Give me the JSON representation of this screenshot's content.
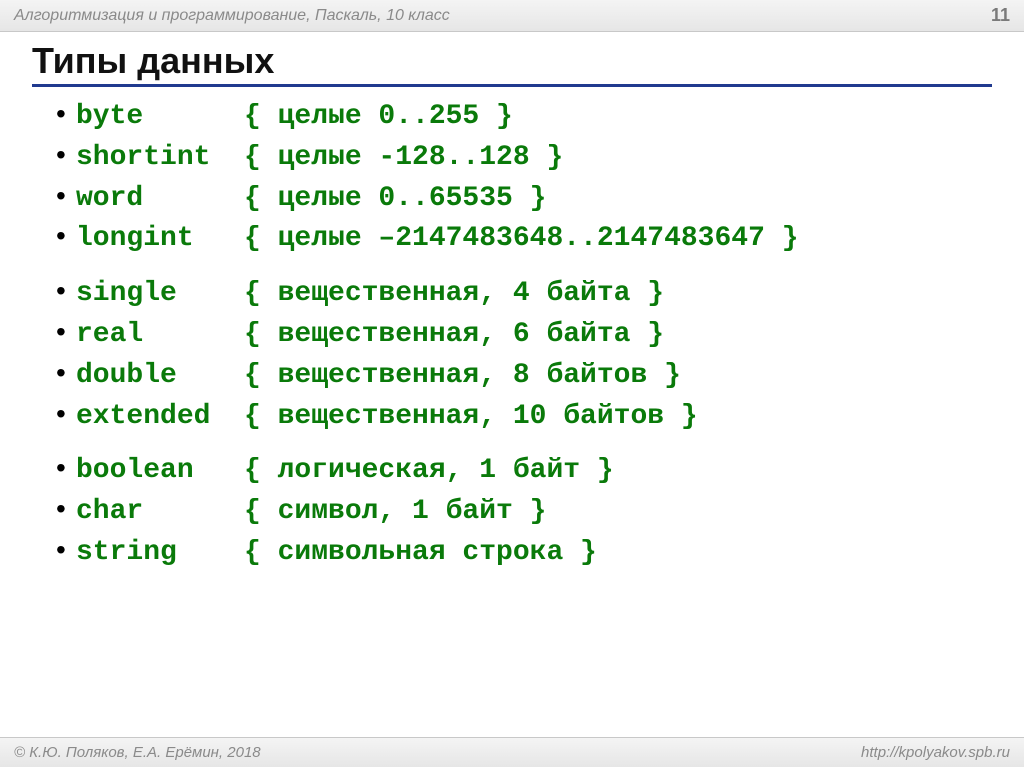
{
  "header": {
    "course": "Алгоритмизация и программирование, Паскаль, 10 класс",
    "page": "11"
  },
  "title": "Типы данных",
  "groups": [
    {
      "rows": [
        {
          "kw": "byte",
          "desc": "{ целые 0..255 }"
        },
        {
          "kw": "shortint",
          "desc": "{ целые -128..128 }"
        },
        {
          "kw": "word",
          "desc": "{ целые 0..65535 }"
        },
        {
          "kw": "longint",
          "desc": "{ целые –2147483648..2147483647 }"
        }
      ]
    },
    {
      "rows": [
        {
          "kw": "single",
          "desc": "{ вещественная, 4 байта }"
        },
        {
          "kw": "real",
          "desc": "{ вещественная, 6 байта }"
        },
        {
          "kw": "double",
          "desc": "{ вещественная, 8 байтов }"
        },
        {
          "kw": "extended",
          "desc": "{ вещественная, 10 байтов }"
        }
      ]
    },
    {
      "rows": [
        {
          "kw": "boolean",
          "desc": "{ логическая, 1 байт }"
        },
        {
          "kw": "char",
          "desc": "{ символ, 1 байт }"
        },
        {
          "kw": "string",
          "desc": "{ символьная строка }"
        }
      ]
    }
  ],
  "footer": {
    "copyright": "© К.Ю. Поляков, Е.А. Ерёмин, 2018",
    "url": "http://kpolyakov.spb.ru"
  }
}
